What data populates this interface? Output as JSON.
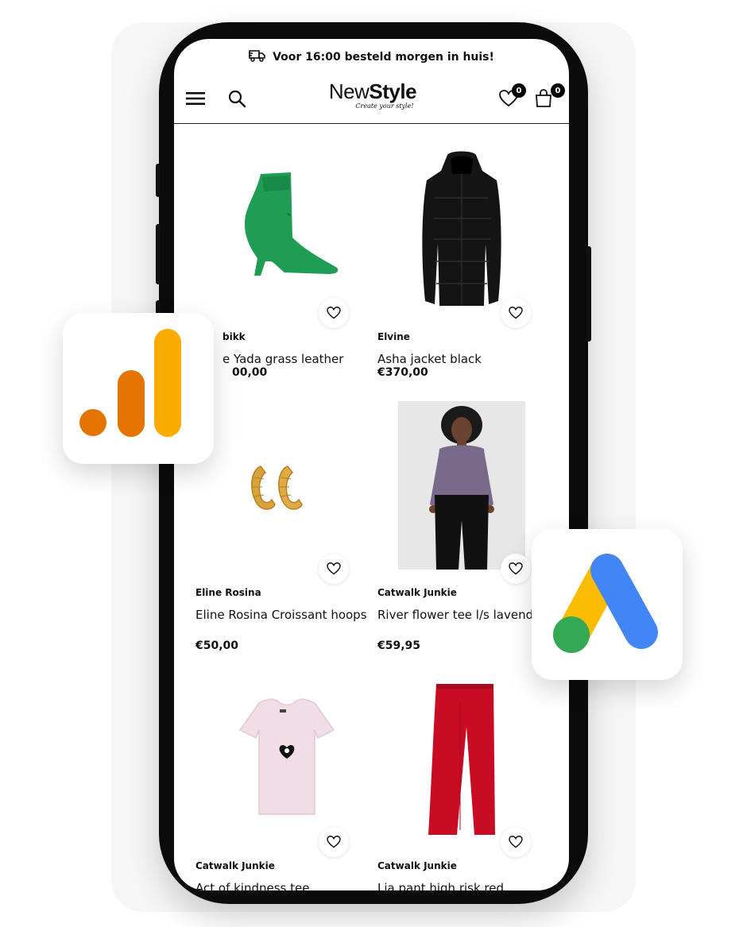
{
  "topbar": {
    "delivery_text": "Voor 16:00 besteld morgen in huis!",
    "icon": "truck-icon"
  },
  "header": {
    "logo_main_light": "New",
    "logo_main_bold": "Style",
    "logo_tagline": "Create your style!",
    "wishlist_count": "0",
    "cart_count": "0"
  },
  "products": [
    {
      "brand": "bikk",
      "name": "e Yada grass leather",
      "price": "00,00",
      "image": "green-ankle-boot"
    },
    {
      "brand": "Elvine",
      "name": "Asha jacket black",
      "price": "€370,00",
      "image": "black-long-coat"
    },
    {
      "brand": "Eline Rosina",
      "name": "Eline Rosina Croissant hoops",
      "price": "€50,00",
      "image": "gold-hoop-earrings"
    },
    {
      "brand": "Catwalk Junkie",
      "name": "River flower tee l/s lavendula",
      "price": "€59,95",
      "image": "model-floral-top"
    },
    {
      "brand": "Catwalk Junkie",
      "name": "Act of kindness tee",
      "price": "",
      "image": "pink-tshirt"
    },
    {
      "brand": "Catwalk Junkie",
      "name": "Lia pant high risk red",
      "price": "",
      "image": "red-trousers"
    }
  ],
  "overlays": {
    "analytics": "google-analytics-icon",
    "ads": "google-ads-icon"
  },
  "colors": {
    "ads_blue": "#4285F4",
    "ads_yellow": "#FBBC04",
    "ads_green": "#34A853",
    "analytics_orange": "#E37400",
    "analytics_yellow": "#F9AB00"
  }
}
